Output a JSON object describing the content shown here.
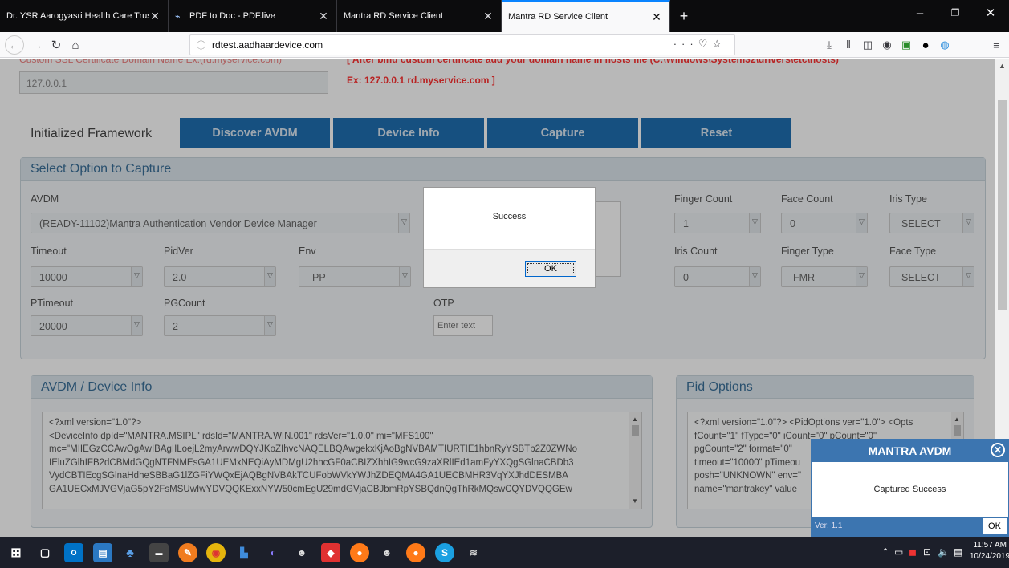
{
  "browser": {
    "tabs": [
      {
        "label": "Dr. YSR Aarogyasri Health Care Trus",
        "active": false
      },
      {
        "label": "PDF to Doc - PDF.live",
        "active": false
      },
      {
        "label": "Mantra RD Service Client",
        "active": false
      },
      {
        "label": "Mantra RD Service Client",
        "active": true
      }
    ],
    "url_host": "rdtest.aadhaardevice.com"
  },
  "page": {
    "cert_label": "Custom SSL Certificate Domain Name Ex.(rd.myservice.com)",
    "cert_note_line1": "[ After bind custom certificate add your domain name in hosts file (C:\\Windows\\System32\\drivers\\etc\\hosts)",
    "cert_note_line2": "Ex: 127.0.0.1 rd.myservice.com ]",
    "cert_value": "127.0.0.1",
    "framework_status": "Initialized Framework",
    "buttons": {
      "discover": "Discover AVDM",
      "device_info": "Device Info",
      "capture": "Capture",
      "reset": "Reset"
    },
    "capture_panel": {
      "title": "Select Option to Capture",
      "avdm_label": "AVDM",
      "avdm_value": "(READY-11102)Mantra Authentication Vendor Device Manager",
      "timeout_label": "Timeout",
      "timeout_value": "10000",
      "pidver_label": "PidVer",
      "pidver_value": "2.0",
      "env_label": "Env",
      "env_value": "PP",
      "ptimeout_label": "PTimeout",
      "ptimeout_value": "20000",
      "pgcount_label": "PGCount",
      "pgcount_value": "2",
      "otp_label": "OTP",
      "otp_placeholder": "Enter text",
      "finger_count_label": "Finger Count",
      "finger_count_value": "1",
      "face_count_label": "Face Count",
      "face_count_value": "0",
      "iris_type_label": "Iris Type",
      "iris_type_value": "SELECT",
      "iris_count_label": "Iris Count",
      "iris_count_value": "0",
      "finger_type_label": "Finger Type",
      "finger_type_value": "FMR",
      "face_type_label": "Face Type",
      "face_type_value": "SELECT"
    },
    "device_info_panel": {
      "title": "AVDM / Device Info",
      "xml_lines": [
        "<?xml version=\"1.0\"?>",
        "<DeviceInfo dpId=\"MANTRA.MSIPL\" rdsId=\"MANTRA.WIN.001\" rdsVer=\"1.0.0\" mi=\"MFS100\"",
        "mc=\"MIIEGzCCAwOgAwIBAgIILoejL2myArwwDQYJKoZIhvcNAQELBQAwgekxKjAoBgNVBAMTIURTIE1hbnRyYSBTb2Z0ZWNo",
        "IEluZGlhIFB2dCBMdGQgNTFNMEsGA1UEMxNEQiAyMDMgU2hhcGF0aCBIZXhhIG9wcG9zaXRlIEd1amFyYXQgSGlnaCBDb3",
        "VydCBTIEcgSGlnaHdheSBBaG1lZGFiYWQxEjAQBgNVBAkTCUFobWVkYWJhZDEQMA4GA1UECBMHR3VqYXJhdDESMBA",
        "GA1UECxMJVGVjaG5pY2FsMSUwIwYDVQQKExxNYW50cmEgU29mdGVjaCBJbmRpYSBQdnQgThRkMQswCQYDVQQGEw"
      ]
    },
    "pid_panel": {
      "title": "Pid Options",
      "xml_lines": [
        "<?xml version=\"1.0\"?> <PidOptions ver=\"1.0\"> <Opts",
        "fCount=\"1\" fType=\"0\" iCount=\"0\" pCount=\"0\"",
        "pgCount=\"2\" format=\"0\"",
        "timeout=\"10000\" pTimeou",
        "posh=\"UNKNOWN\" env=\"",
        "name=\"mantrakey\" value"
      ]
    }
  },
  "dialog": {
    "message": "Success",
    "ok_label": "OK"
  },
  "mantra_popup": {
    "title": "MANTRA AVDM",
    "message": "Captured Success",
    "version": "Ver: 1.1",
    "ok_label": "OK"
  },
  "taskbar": {
    "time": "11:57 AM",
    "date": "10/24/2019"
  }
}
